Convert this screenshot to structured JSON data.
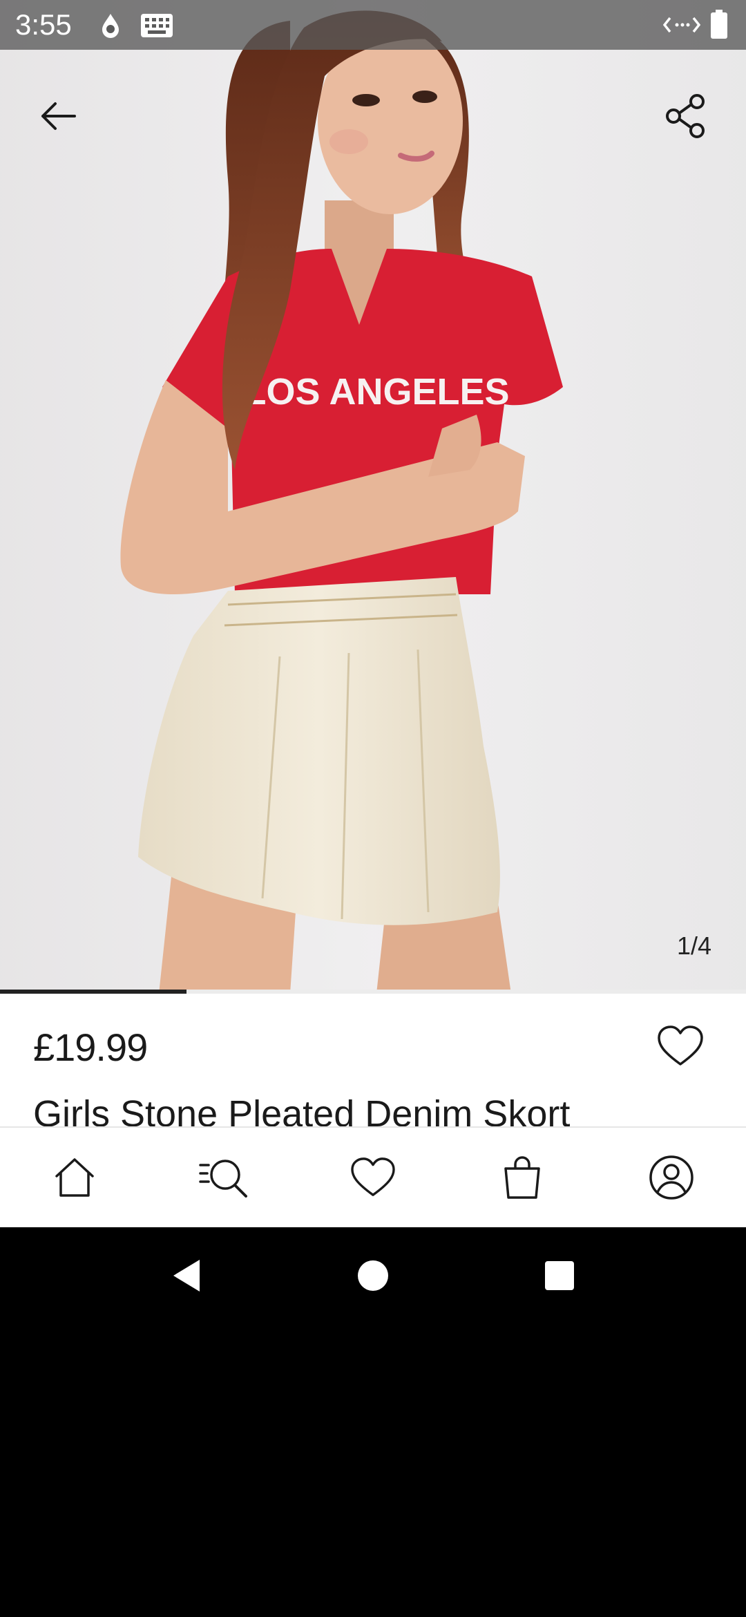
{
  "status_bar": {
    "time": "3:55",
    "icons": [
      "water-drop-icon",
      "keyboard-icon",
      "signal-icon",
      "battery-icon"
    ]
  },
  "image_overlay": {
    "back_icon": "arrow-left-icon",
    "share_icon": "share-icon",
    "counter": "1/4",
    "carousel_progress": 0.25,
    "shirt_text": "LOS ANGELES"
  },
  "product": {
    "price": "£19.99",
    "title": "Girls Stone Pleated Denim Skort",
    "wishlist_icon": "heart-outline-icon"
  },
  "bottom_nav": {
    "items": [
      {
        "name": "home",
        "icon": "home-icon"
      },
      {
        "name": "search",
        "icon": "search-icon"
      },
      {
        "name": "wishlist",
        "icon": "heart-icon"
      },
      {
        "name": "bag",
        "icon": "shopping-bag-icon"
      },
      {
        "name": "account",
        "icon": "account-icon"
      }
    ]
  },
  "system_nav": {
    "items": [
      "back-triangle-icon",
      "home-circle-icon",
      "recents-square-icon"
    ]
  },
  "colors": {
    "shirt": "#d81f33",
    "skirt": "#efe6d2",
    "hair": "#7a3a22",
    "skin": "#e9b99c",
    "text": "#1a1a1a"
  }
}
